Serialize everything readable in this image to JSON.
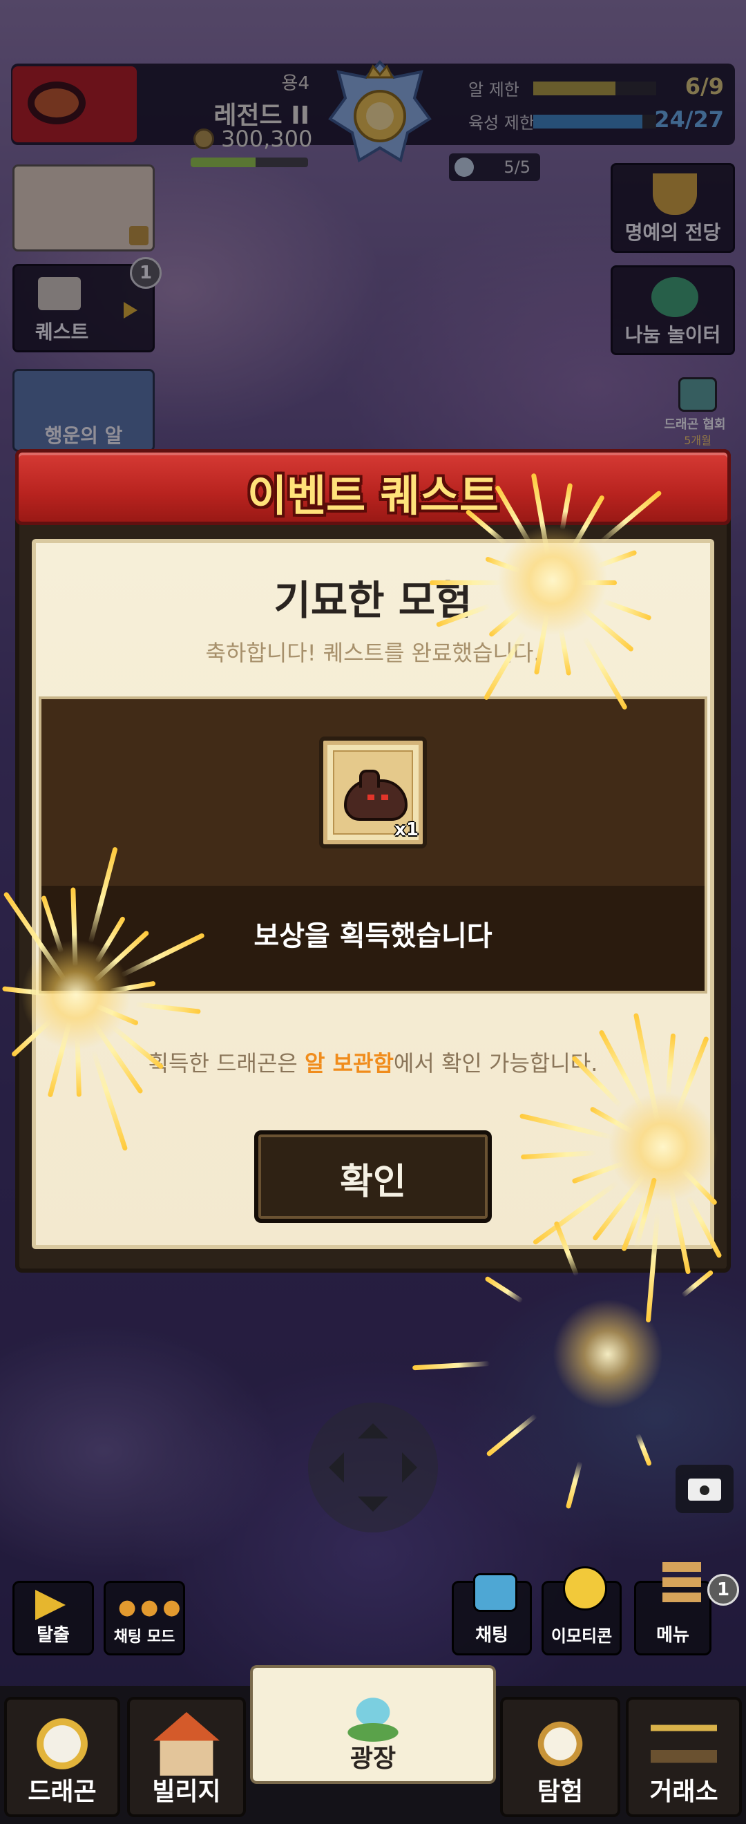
{
  "hud": {
    "rank_tier": "용4",
    "rank_name": "레전드 II",
    "coins": "300,300",
    "egg_limit_label": "알 제한",
    "egg_limit_value": "6/9",
    "egg_limit_fraction": 0.67,
    "breed_limit_label": "육성 제한",
    "breed_limit_value": "24/27",
    "breed_limit_fraction": 0.89,
    "slot_value": "5/5"
  },
  "left_side": {
    "quest_label": "퀘스트",
    "quest_badge": "1",
    "lucky_egg_label": "행운의 알"
  },
  "right_side": {
    "hall_of_fame_label": "명예의 전당",
    "playground_label": "나눔 놀이터",
    "association_label": "드래곤 협회",
    "association_sub": "5개월"
  },
  "dialog": {
    "header_title": "이벤트 퀘스트",
    "quest_name": "기묘한 모험",
    "quest_subtitle": "축하합니다! 퀘스트를 완료했습니다.",
    "reward_qty": "x1",
    "reward_message": "보상을 획득했습니다",
    "info_prefix": "획득한 드래곤은 ",
    "info_highlight": "알 보관함",
    "info_suffix": "에서 확인 가능합니다.",
    "confirm_label": "확인"
  },
  "actions": {
    "escape_label": "탈출",
    "chat_mode_label": "채팅 모드",
    "chat_label": "채팅",
    "emoticon_label": "이모티콘",
    "menu_label": "메뉴",
    "menu_badge": "1"
  },
  "nav": {
    "items": [
      {
        "label": "드래곤"
      },
      {
        "label": "빌리지"
      },
      {
        "label": "광장"
      },
      {
        "label": "탐험"
      },
      {
        "label": "거래소"
      }
    ],
    "active_index": 2
  },
  "colors": {
    "header_red": "#c42a25",
    "title_gold": "#ffe27a",
    "highlight_orange": "#f08c1c",
    "egg_bar": "#b5a23c",
    "breed_bar": "#3f8bc4"
  }
}
